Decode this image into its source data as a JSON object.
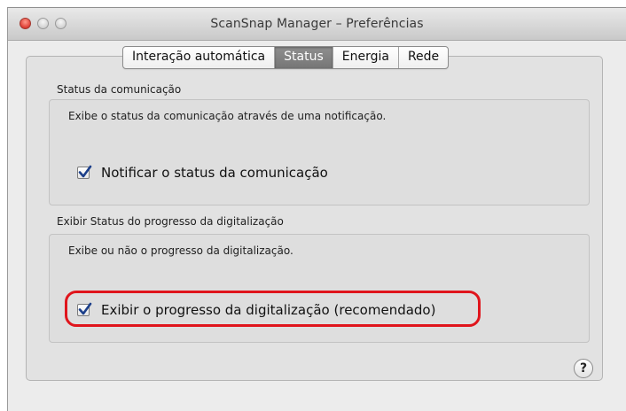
{
  "window": {
    "title": "ScanSnap Manager – Preferências"
  },
  "tabs": [
    {
      "label": "Interação automática",
      "selected": false
    },
    {
      "label": "Status",
      "selected": true
    },
    {
      "label": "Energia",
      "selected": false
    },
    {
      "label": "Rede",
      "selected": false
    }
  ],
  "communication_status": {
    "section_title": "Status da comunicação",
    "description": "Exibe o status da comunicação através de uma notificação.",
    "checkbox_label": "Notificar o status da comunicação",
    "checked": true
  },
  "scan_progress": {
    "section_title": "Exibir Status do progresso da digitalização",
    "description": "Exibe ou não o progresso da digitalização.",
    "checkbox_label": "Exibir o progresso da digitalização (recomendado)",
    "checked": true
  },
  "help": {
    "icon": "help-icon",
    "symbol": "?"
  },
  "colors": {
    "highlight": "#e0151c",
    "checkmark": "#1c3f8a",
    "close_button": "#e0443a"
  }
}
